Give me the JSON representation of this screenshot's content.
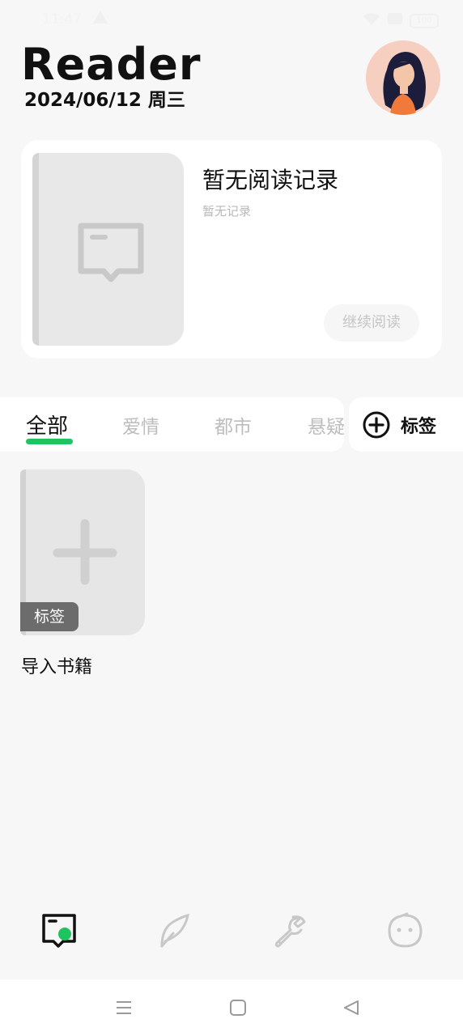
{
  "status_bar": {
    "time": "11:47",
    "battery": "100"
  },
  "header": {
    "title": "Reader",
    "date": "2024/06/12 周三"
  },
  "recent": {
    "title": "暂无阅读记录",
    "subtitle": "暂无记录",
    "continue_label": "继续阅读"
  },
  "tabs": [
    {
      "label": "全部",
      "active": true
    },
    {
      "label": "爱情",
      "active": false
    },
    {
      "label": "都市",
      "active": false
    },
    {
      "label": "悬疑",
      "active": false
    }
  ],
  "tag_button": {
    "label": "标签"
  },
  "import_item": {
    "badge": "标签",
    "label": "导入书籍"
  },
  "bottom_nav": [
    {
      "icon": "bookshelf-icon",
      "active": true
    },
    {
      "icon": "feather-icon",
      "active": false
    },
    {
      "icon": "wrench-icon",
      "active": false
    },
    {
      "icon": "profile-face-icon",
      "active": false
    }
  ],
  "colors": {
    "accent": "#1fc35f",
    "background": "#f7f7f7",
    "inactive": "#bdbdbd"
  }
}
